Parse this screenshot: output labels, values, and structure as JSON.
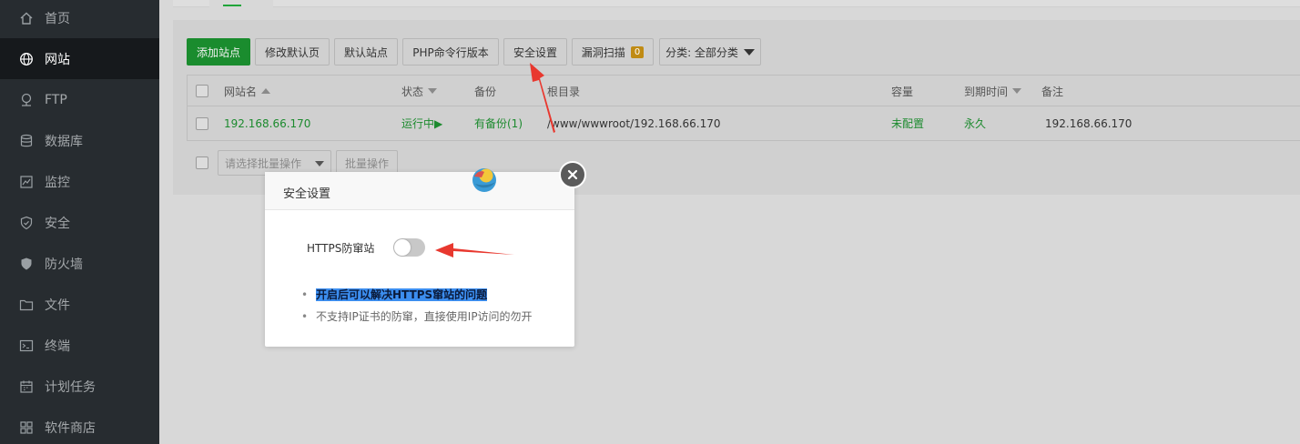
{
  "sidebar": {
    "items": [
      {
        "label": "首页",
        "icon": "home-icon"
      },
      {
        "label": "网站",
        "icon": "globe-icon"
      },
      {
        "label": "FTP",
        "icon": "ftp-icon"
      },
      {
        "label": "数据库",
        "icon": "database-icon"
      },
      {
        "label": "监控",
        "icon": "monitor-icon"
      },
      {
        "label": "安全",
        "icon": "shield-icon"
      },
      {
        "label": "防火墙",
        "icon": "firewall-icon"
      },
      {
        "label": "文件",
        "icon": "folder-icon"
      },
      {
        "label": "终端",
        "icon": "terminal-icon"
      },
      {
        "label": "计划任务",
        "icon": "calendar-icon"
      },
      {
        "label": "软件商店",
        "icon": "apps-icon"
      }
    ],
    "active_index": 1
  },
  "toolbar": {
    "add_site": "添加站点",
    "edit_default_page": "修改默认页",
    "default_site": "默认站点",
    "php_cli_version": "PHP命令行版本",
    "security_settings": "安全设置",
    "vuln_scan": "漏洞扫描",
    "vuln_count": "0",
    "category": "分类: 全部分类"
  },
  "table": {
    "headers": {
      "site_name": "网站名",
      "status": "状态",
      "backup": "备份",
      "root_dir": "根目录",
      "capacity": "容量",
      "expire": "到期时间",
      "note": "备注"
    },
    "rows": [
      {
        "site_name": "192.168.66.170",
        "status": "运行中▶",
        "backup": "有备份(1)",
        "root_dir": "/www/wwwroot/192.168.66.170",
        "capacity": "未配置",
        "expire": "永久",
        "note": "192.168.66.170"
      }
    ]
  },
  "batch": {
    "select_placeholder": "请选择批量操作",
    "button": "批量操作"
  },
  "dialog": {
    "title": "安全设置",
    "https_label": "HTTPS防窜站",
    "https_enabled": false,
    "tips": [
      "开启后可以解决HTTPS窜站的问题",
      "不支持IP证书的防窜，直接使用IP访问的勿开"
    ]
  },
  "colors": {
    "accent_green": "#20a53a",
    "annotation_red": "#e8382f",
    "sidebar_bg": "#272c30"
  }
}
